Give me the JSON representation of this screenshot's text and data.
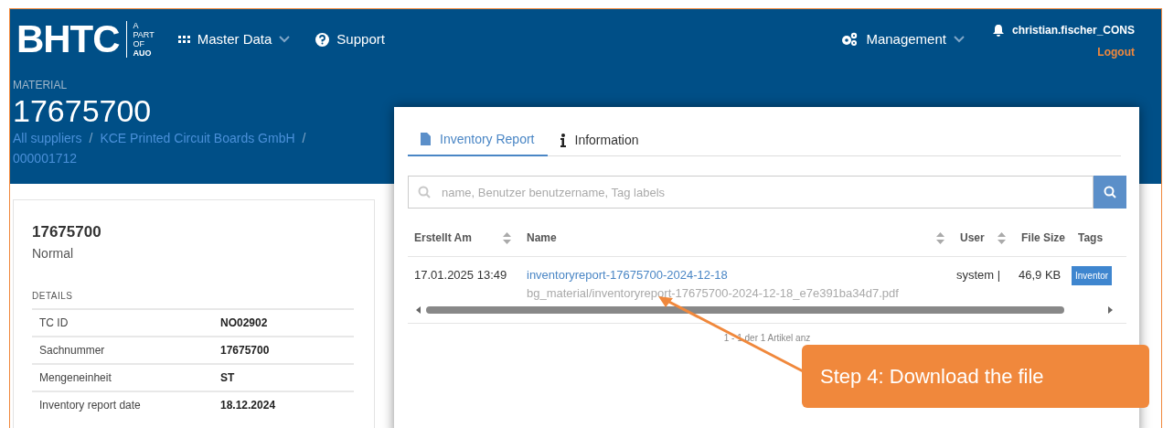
{
  "header": {
    "logo": {
      "brand": "BHTC",
      "tagline": [
        "A",
        "PART",
        "OF",
        "AUO"
      ]
    },
    "nav": [
      {
        "kind": "grid",
        "label": "Master Data",
        "dropdown": true
      },
      {
        "kind": "help",
        "label": "Support",
        "dropdown": false
      },
      {
        "kind": "gears",
        "label": "Management",
        "dropdown": true
      }
    ],
    "user": {
      "name": "christian.fischer_CONS",
      "logout": "Logout"
    }
  },
  "material": {
    "label": "MATERIAL",
    "number": "17675700",
    "breadcrumbs": [
      "All suppliers",
      "KCE Printed Circuit Boards GmbH",
      "000001712"
    ],
    "separator": "/"
  },
  "card": {
    "title": "17675700",
    "subtitle": "Normal",
    "section": "DETAILS",
    "rows": [
      {
        "label": "TC ID",
        "value": "NO02902"
      },
      {
        "label": "Sachnummer",
        "value": "17675700"
      },
      {
        "label": "Mengeneinheit",
        "value": "ST"
      },
      {
        "label": "Inventory report date",
        "value": "18.12.2024"
      }
    ]
  },
  "panel": {
    "tabs": [
      {
        "kind": "file",
        "label": "Inventory Report",
        "selected": true
      },
      {
        "kind": "info",
        "label": "Information",
        "selected": false
      }
    ],
    "search": {
      "placeholder": "name, Benutzer benutzername, Tag labels"
    },
    "table": {
      "columns": [
        {
          "label": "Erstellt Am",
          "sortable": true
        },
        {
          "label": "Name",
          "sortable": true
        },
        {
          "label": "User",
          "sortable": true
        },
        {
          "label": "File Size",
          "sortable": false
        },
        {
          "label": "Tags",
          "sortable": false
        }
      ],
      "rows": [
        {
          "created": "17.01.2025 13:49",
          "name": "inventoryreport-17675700-2024-12-18",
          "path": "bg_material/inventoryreport-17675700-2024-12-18_e7e391ba34d7.pdf",
          "user": "system |",
          "size": "46,9 KB",
          "tag": "Inventor"
        }
      ]
    },
    "pager": "1 - 1 der 1 Artikel anz"
  },
  "callout": {
    "text": "Step 4: Download the file"
  }
}
